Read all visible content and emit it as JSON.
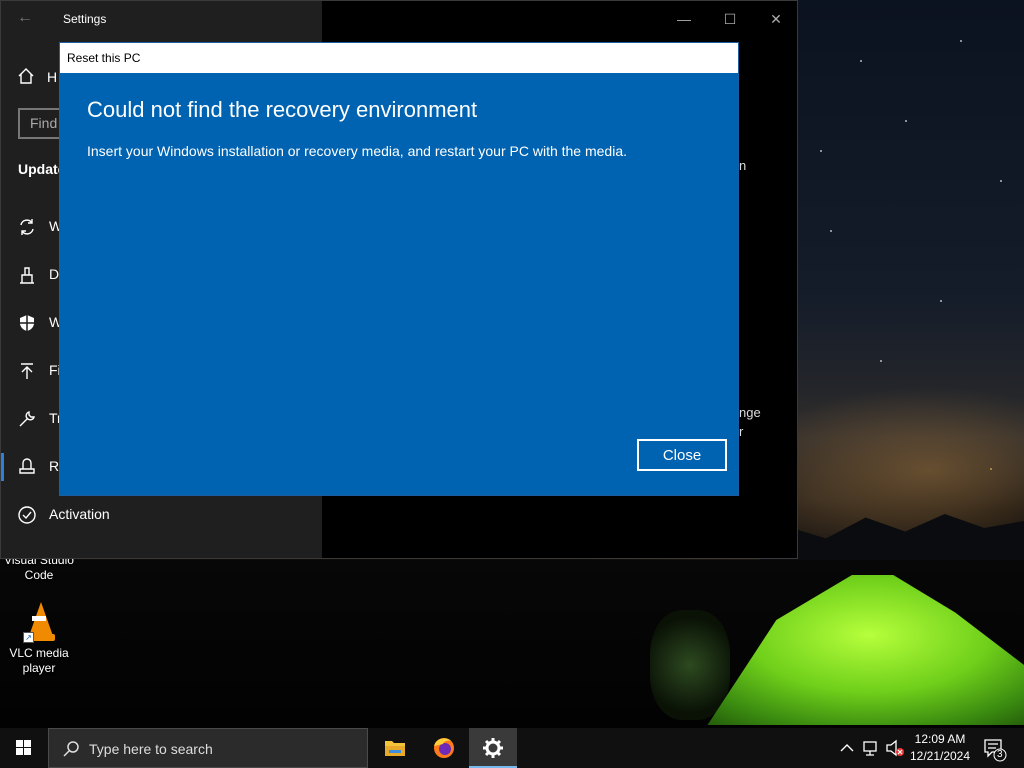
{
  "desktop": {
    "icons": [
      {
        "label_line1": "Visual Studio",
        "label_line2": "Code"
      },
      {
        "label_line1": "VLC media",
        "label_line2": "player"
      }
    ]
  },
  "settings": {
    "title": "Settings",
    "home_label": "H",
    "find_placeholder": "Find",
    "section_title": "Update",
    "nav": [
      {
        "label": "W",
        "icon": "sync-icon"
      },
      {
        "label": "D",
        "icon": "delivery-optimization-icon"
      },
      {
        "label": "W",
        "icon": "shield-icon"
      },
      {
        "label": "Fi",
        "icon": "backup-arrow-icon"
      },
      {
        "label": "Tr",
        "icon": "wrench-icon"
      },
      {
        "label": "R",
        "icon": "recovery-icon"
      },
      {
        "label": "Activation",
        "icon": "check-circle-icon"
      }
    ],
    "peek": {
      "line_a": "nge",
      "line_b": "r",
      "line_c": "n"
    }
  },
  "dialog": {
    "title": "Reset this PC",
    "heading": "Could not find the recovery environment",
    "body": "Insert your Windows installation or recovery media, and restart your PC with the media.",
    "close_label": "Close"
  },
  "taskbar": {
    "search_placeholder": "Type here to search",
    "time": "12:09 AM",
    "date": "12/21/2024",
    "notification_count": "3"
  }
}
